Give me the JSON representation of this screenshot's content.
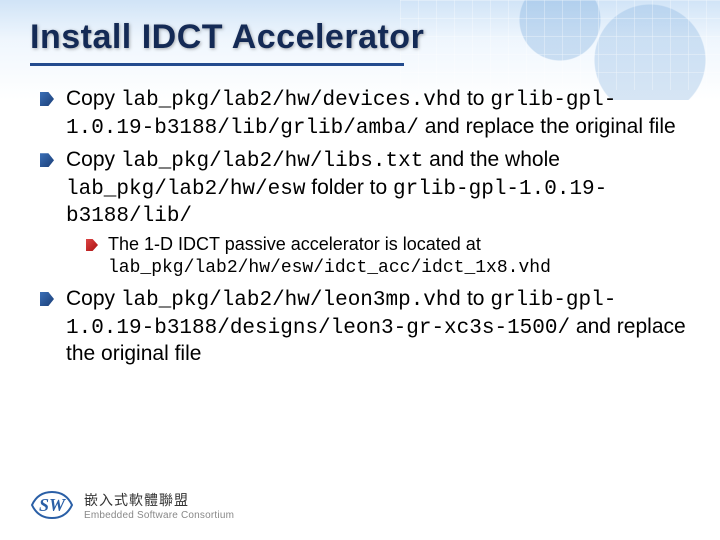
{
  "title": "Install IDCT Accelerator",
  "bullets": {
    "b0": {
      "pre": "Copy ",
      "path1": "lab_pkg/lab2/hw/devices.vhd",
      "mid1": " to ",
      "path2": "grlib-gpl-1.0.19-b3188/lib/grlib/amba/",
      "tail": " and replace the original file"
    },
    "b1": {
      "pre": "Copy ",
      "path1": "lab_pkg/lab2/hw/libs.txt",
      "mid1": " and the whole ",
      "path2": "lab_pkg/lab2/hw/esw",
      "mid2": " folder to ",
      "path3": "grlib-gpl-1.0.19-b3188/lib/"
    },
    "b1s0": {
      "pre": "The 1-D IDCT passive accelerator is located at ",
      "path1": "lab_pkg/lab2/hw/esw/idct_acc/idct_1x8.vhd"
    },
    "b2": {
      "pre": "Copy ",
      "path1": "lab_pkg/lab2/hw/leon3mp.vhd",
      "mid1": " to ",
      "path2": "grlib-gpl-1.0.19-b3188/designs/leon3-gr-xc3s-1500/",
      "tail": " and replace the original file"
    }
  },
  "footer": {
    "cn": "嵌入式軟體聯盟",
    "en": "Embedded Software Consortium"
  },
  "colors": {
    "accent": "#234b8e"
  }
}
